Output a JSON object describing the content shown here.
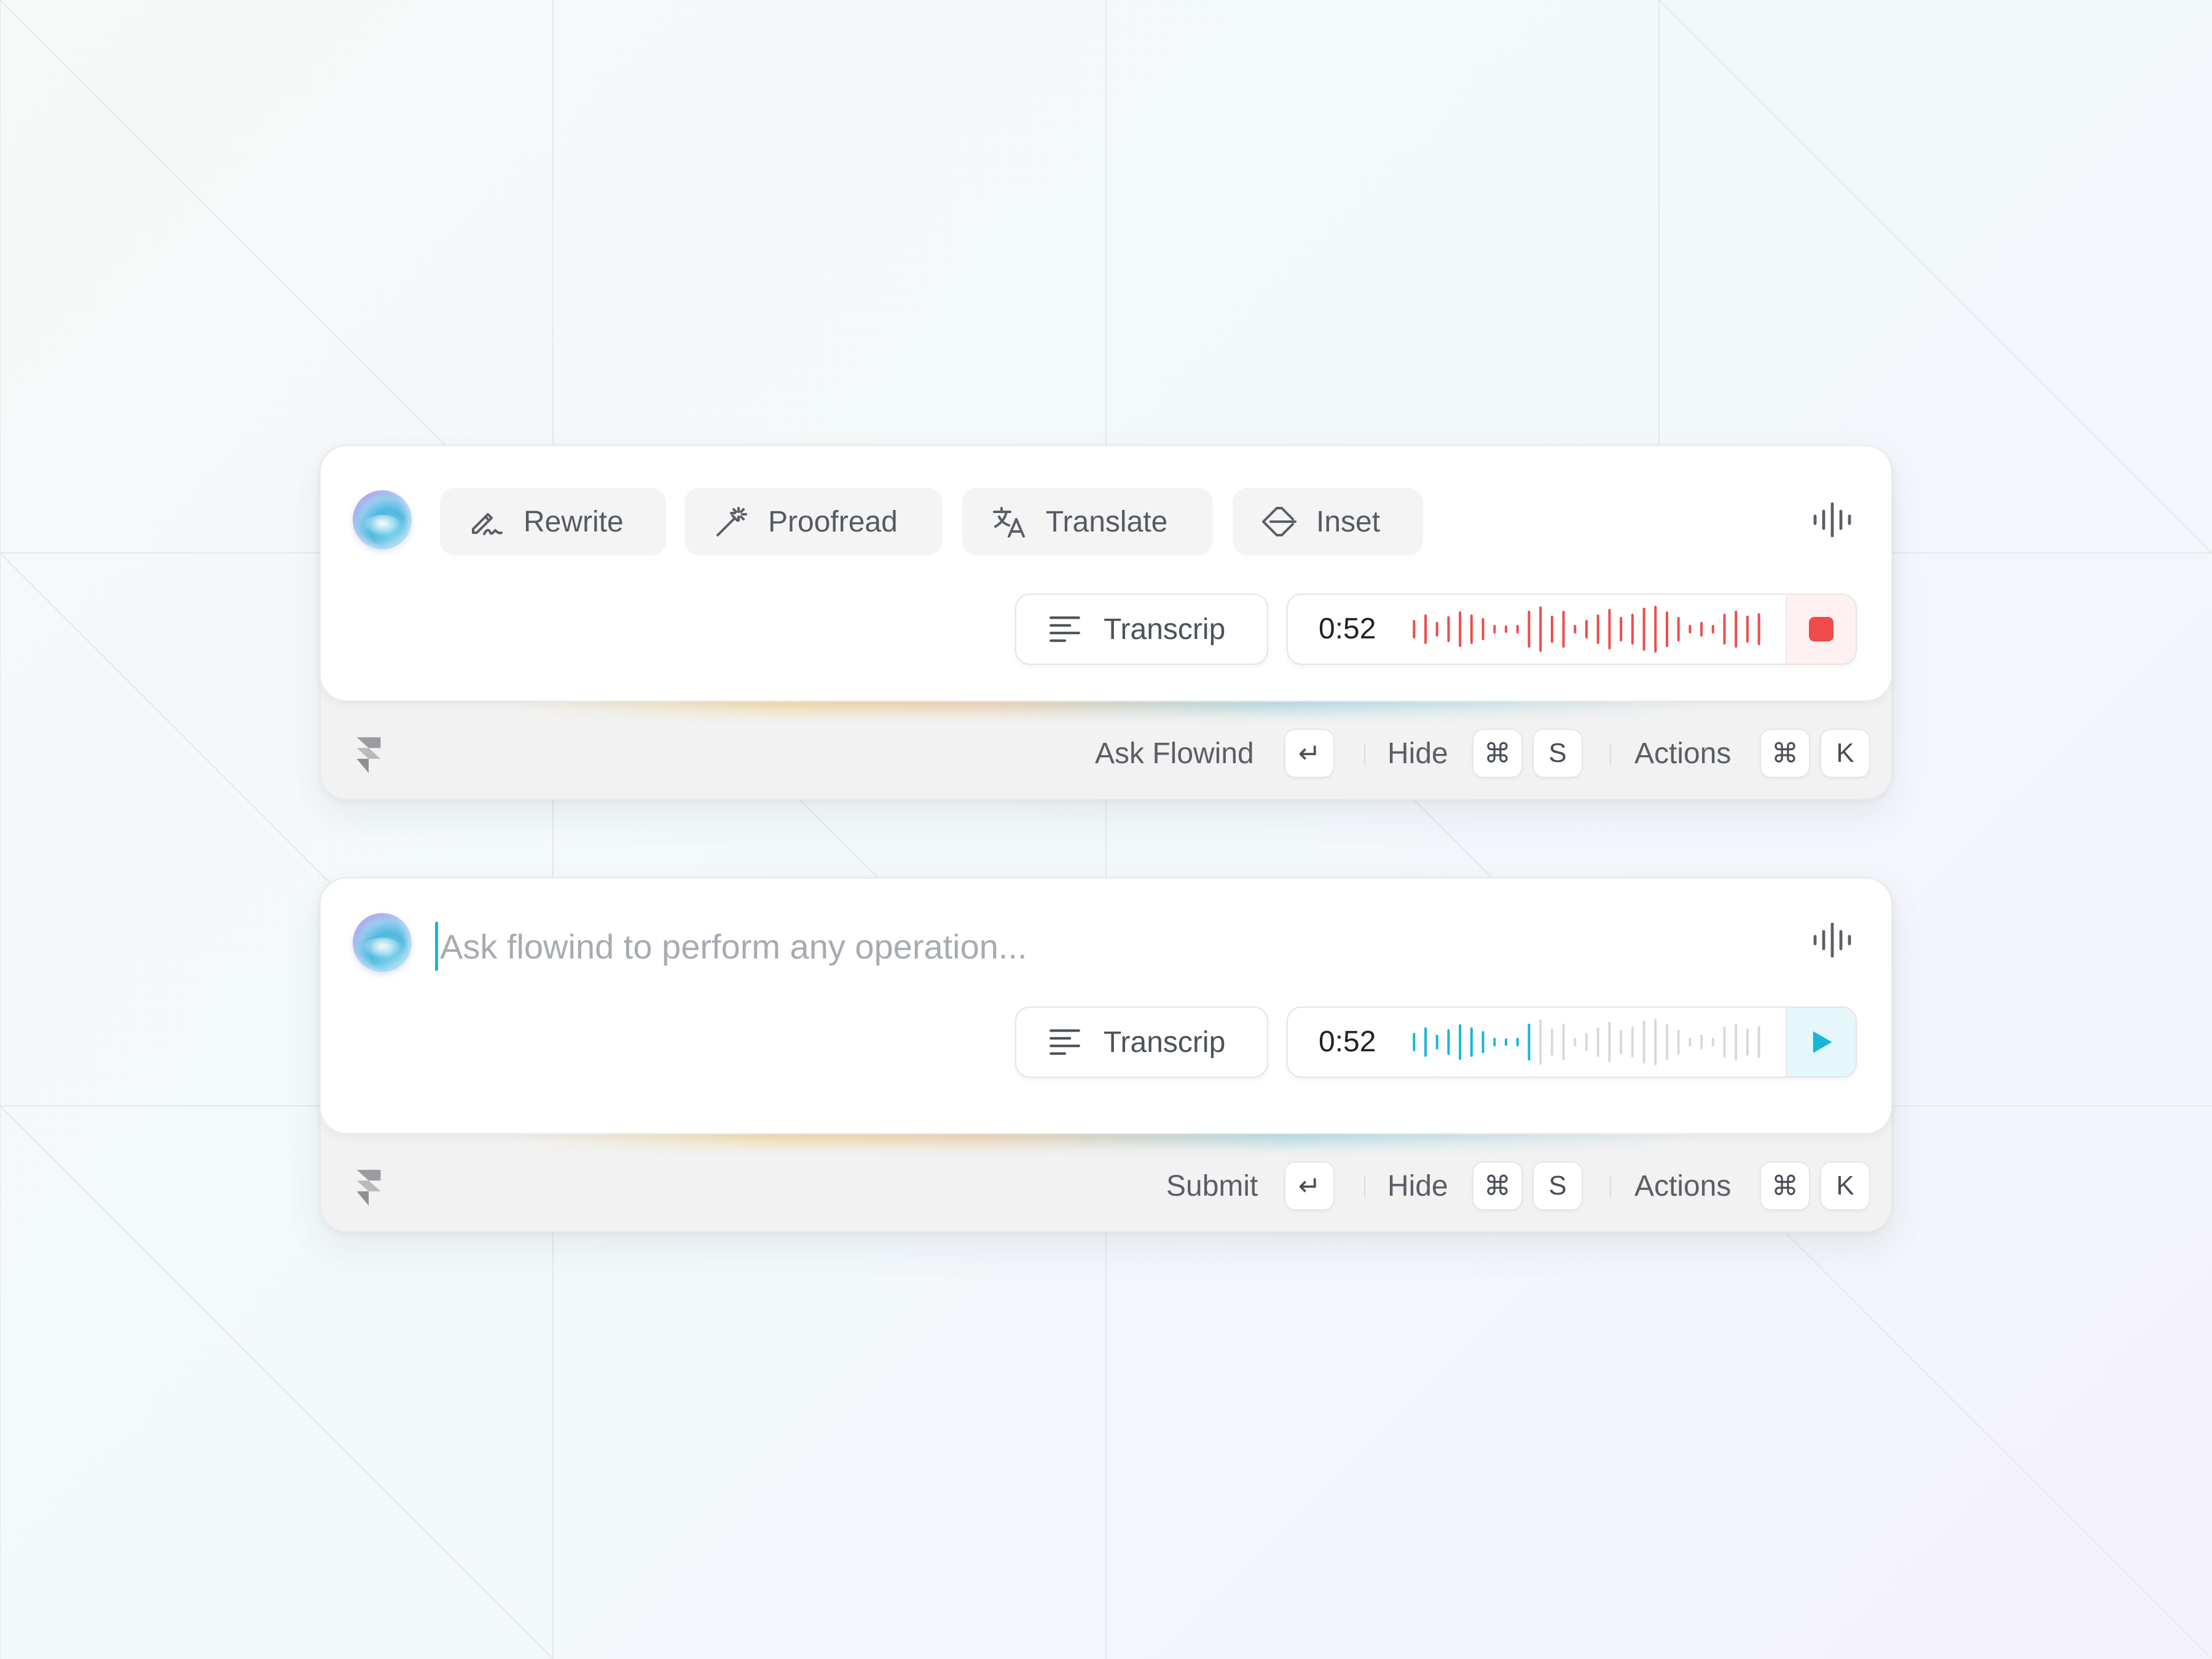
{
  "colors": {
    "recording_accent": "#ef4b4b",
    "playback_accent": "#16b6d9",
    "played_out": "#d8d9dc"
  },
  "top_widget": {
    "chips": [
      {
        "label": "Rewrite",
        "icon": "signature-pen-icon"
      },
      {
        "label": "Proofread",
        "icon": "magic-wand-icon"
      },
      {
        "label": "Translate",
        "icon": "translate-icon"
      },
      {
        "label": "Inset",
        "icon": "insert-arrow-icon"
      }
    ],
    "transcript_label": "Transcrip",
    "time": "0:52",
    "waveform_state": "recording",
    "footer": {
      "primary_label": "Ask Flowind",
      "primary_key": "↵",
      "hide_label": "Hide",
      "hide_keys": [
        "⌘",
        "S"
      ],
      "actions_label": "Actions",
      "actions_keys": [
        "⌘",
        "K"
      ]
    }
  },
  "bottom_widget": {
    "placeholder": "Ask flowind to perform any operation...",
    "transcript_label": "Transcrip",
    "time": "0:52",
    "waveform_state": "playback",
    "footer": {
      "primary_label": "Submit",
      "primary_key": "↵",
      "hide_label": "Hide",
      "hide_keys": [
        "⌘",
        "S"
      ],
      "actions_label": "Actions",
      "actions_keys": [
        "⌘",
        "K"
      ]
    }
  }
}
